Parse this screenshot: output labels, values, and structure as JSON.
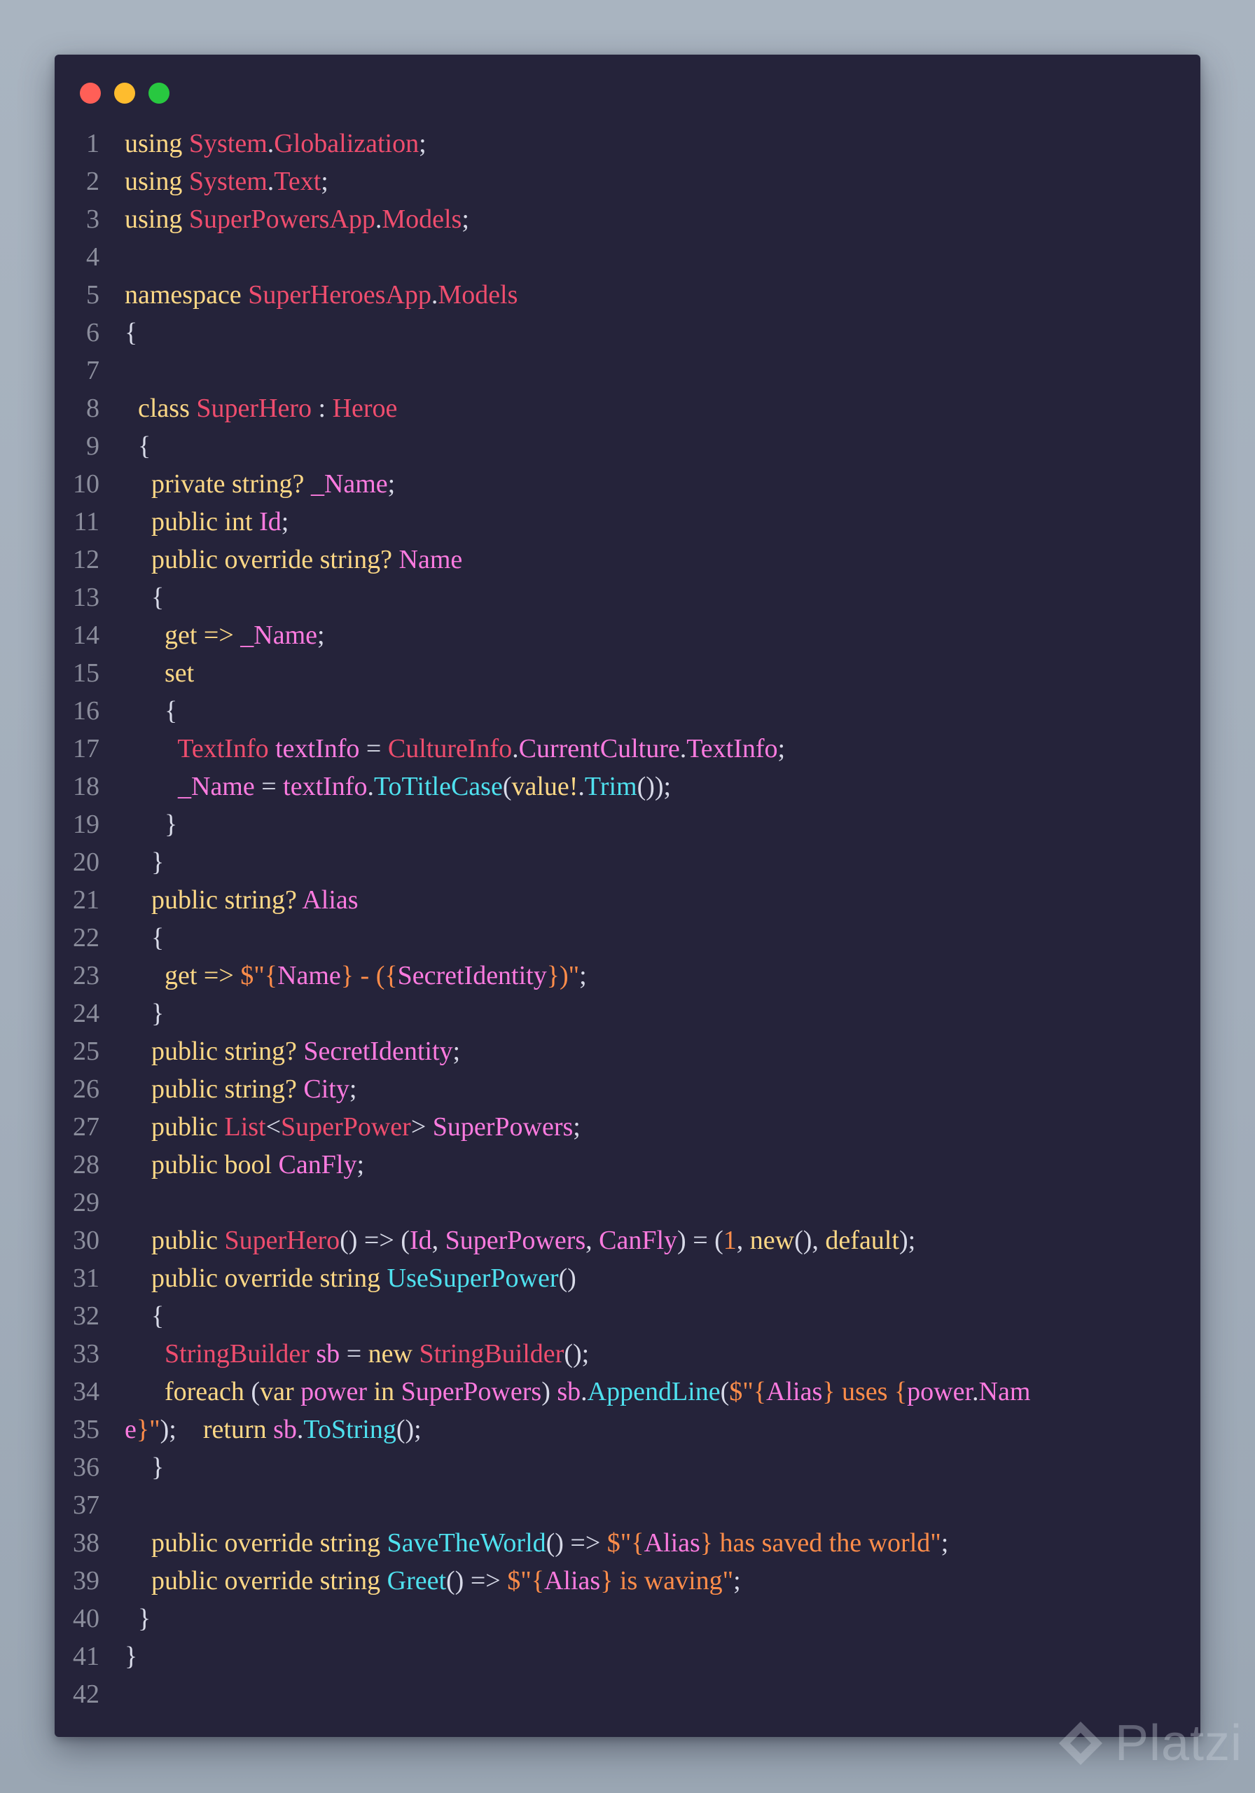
{
  "window": {
    "buttons": [
      {
        "name": "close",
        "color": "#ff5f57"
      },
      {
        "name": "minimize",
        "color": "#febc2e"
      },
      {
        "name": "maximize",
        "color": "#28c840"
      }
    ]
  },
  "watermark": {
    "text": "Platzi",
    "icon": "platzi-logo-icon"
  },
  "colors": {
    "background": "#a6b1bd",
    "editor": "#25233a",
    "keyword": "#fdd886",
    "type": "#ef4d6e",
    "identifier": "#fd7be0",
    "function": "#4fe1ef",
    "string": "#ff8d4a",
    "punctuation": "#d8dae8",
    "line_number": "#8b8d9c"
  },
  "code": {
    "lines": [
      {
        "n": "1",
        "tokens": [
          [
            "kw",
            "using "
          ],
          [
            "ty",
            "System"
          ],
          [
            "pu",
            "."
          ],
          [
            "ty",
            "Globalization"
          ],
          [
            "pu",
            ";"
          ]
        ]
      },
      {
        "n": "2",
        "tokens": [
          [
            "kw",
            "using "
          ],
          [
            "ty",
            "System"
          ],
          [
            "pu",
            "."
          ],
          [
            "ty",
            "Text"
          ],
          [
            "pu",
            ";"
          ]
        ]
      },
      {
        "n": "3",
        "tokens": [
          [
            "kw",
            "using "
          ],
          [
            "ty",
            "SuperPowersApp"
          ],
          [
            "pu",
            "."
          ],
          [
            "ty",
            "Models"
          ],
          [
            "pu",
            ";"
          ]
        ]
      },
      {
        "n": "4",
        "tokens": []
      },
      {
        "n": "5",
        "tokens": [
          [
            "kw",
            "namespace "
          ],
          [
            "ty",
            "SuperHeroesApp"
          ],
          [
            "pu",
            "."
          ],
          [
            "ty",
            "Models"
          ]
        ]
      },
      {
        "n": "6",
        "tokens": [
          [
            "pu",
            "{"
          ]
        ]
      },
      {
        "n": "7",
        "tokens": []
      },
      {
        "n": "8",
        "tokens": [
          [
            "pu",
            "  "
          ],
          [
            "kw",
            "class "
          ],
          [
            "ty",
            "SuperHero"
          ],
          [
            "pu",
            " : "
          ],
          [
            "ty",
            "Heroe"
          ]
        ]
      },
      {
        "n": "9",
        "tokens": [
          [
            "pu",
            "  {"
          ]
        ]
      },
      {
        "n": "10",
        "tokens": [
          [
            "pu",
            "    "
          ],
          [
            "kw",
            "private string? "
          ],
          [
            "id",
            "_Name"
          ],
          [
            "pu",
            ";"
          ]
        ]
      },
      {
        "n": "11",
        "tokens": [
          [
            "pu",
            "    "
          ],
          [
            "kw",
            "public int "
          ],
          [
            "id",
            "Id"
          ],
          [
            "pu",
            ";"
          ]
        ]
      },
      {
        "n": "12",
        "tokens": [
          [
            "pu",
            "    "
          ],
          [
            "kw",
            "public override string? "
          ],
          [
            "id",
            "Name"
          ]
        ]
      },
      {
        "n": "13",
        "tokens": [
          [
            "pu",
            "    {"
          ]
        ]
      },
      {
        "n": "14",
        "tokens": [
          [
            "pu",
            "      "
          ],
          [
            "kw",
            "get => "
          ],
          [
            "id",
            "_Name"
          ],
          [
            "pu",
            ";"
          ]
        ]
      },
      {
        "n": "15",
        "tokens": [
          [
            "pu",
            "      "
          ],
          [
            "kw",
            "set"
          ]
        ]
      },
      {
        "n": "16",
        "tokens": [
          [
            "pu",
            "      {"
          ]
        ]
      },
      {
        "n": "17",
        "tokens": [
          [
            "pu",
            "        "
          ],
          [
            "ty",
            "TextInfo "
          ],
          [
            "id",
            "textInfo"
          ],
          [
            "pu",
            " = "
          ],
          [
            "ty",
            "CultureInfo"
          ],
          [
            "pu",
            "."
          ],
          [
            "id",
            "CurrentCulture"
          ],
          [
            "pu",
            "."
          ],
          [
            "id",
            "TextInfo"
          ],
          [
            "pu",
            ";"
          ]
        ]
      },
      {
        "n": "18",
        "tokens": [
          [
            "pu",
            "        "
          ],
          [
            "id",
            "_Name"
          ],
          [
            "pu",
            " = "
          ],
          [
            "id",
            "textInfo"
          ],
          [
            "pu",
            "."
          ],
          [
            "fn",
            "ToTitleCase"
          ],
          [
            "pu",
            "("
          ],
          [
            "kw",
            "value!"
          ],
          [
            "pu",
            "."
          ],
          [
            "fn",
            "Trim"
          ],
          [
            "pu",
            "());"
          ]
        ]
      },
      {
        "n": "19",
        "tokens": [
          [
            "pu",
            "      }"
          ]
        ]
      },
      {
        "n": "20",
        "tokens": [
          [
            "pu",
            "    }"
          ]
        ]
      },
      {
        "n": "21",
        "tokens": [
          [
            "pu",
            "    "
          ],
          [
            "kw",
            "public string? "
          ],
          [
            "id",
            "Alias"
          ]
        ]
      },
      {
        "n": "22",
        "tokens": [
          [
            "pu",
            "    {"
          ]
        ]
      },
      {
        "n": "23",
        "tokens": [
          [
            "pu",
            "      "
          ],
          [
            "kw",
            "get => "
          ],
          [
            "str",
            "$\"{"
          ],
          [
            "id",
            "Name"
          ],
          [
            "str",
            "} - ({"
          ],
          [
            "id",
            "SecretIdentity"
          ],
          [
            "str",
            "})\""
          ],
          [
            "pu",
            ";"
          ]
        ]
      },
      {
        "n": "24",
        "tokens": [
          [
            "pu",
            "    }"
          ]
        ]
      },
      {
        "n": "25",
        "tokens": [
          [
            "pu",
            "    "
          ],
          [
            "kw",
            "public string? "
          ],
          [
            "id",
            "SecretIdentity"
          ],
          [
            "pu",
            ";"
          ]
        ]
      },
      {
        "n": "26",
        "tokens": [
          [
            "pu",
            "    "
          ],
          [
            "kw",
            "public string? "
          ],
          [
            "id",
            "City"
          ],
          [
            "pu",
            ";"
          ]
        ]
      },
      {
        "n": "27",
        "tokens": [
          [
            "pu",
            "    "
          ],
          [
            "kw",
            "public "
          ],
          [
            "ty",
            "List"
          ],
          [
            "pu",
            "<"
          ],
          [
            "ty",
            "SuperPower"
          ],
          [
            "pu",
            "> "
          ],
          [
            "id",
            "SuperPowers"
          ],
          [
            "pu",
            ";"
          ]
        ]
      },
      {
        "n": "28",
        "tokens": [
          [
            "pu",
            "    "
          ],
          [
            "kw",
            "public bool "
          ],
          [
            "id",
            "CanFly"
          ],
          [
            "pu",
            ";"
          ]
        ]
      },
      {
        "n": "29",
        "tokens": []
      },
      {
        "n": "30",
        "tokens": [
          [
            "pu",
            "    "
          ],
          [
            "kw",
            "public "
          ],
          [
            "ty",
            "SuperHero"
          ],
          [
            "pu",
            "() => ("
          ],
          [
            "id",
            "Id"
          ],
          [
            "pu",
            ", "
          ],
          [
            "id",
            "SuperPowers"
          ],
          [
            "pu",
            ", "
          ],
          [
            "id",
            "CanFly"
          ],
          [
            "pu",
            ") = ("
          ],
          [
            "num",
            "1"
          ],
          [
            "pu",
            ", "
          ],
          [
            "kw",
            "new"
          ],
          [
            "pu",
            "(), "
          ],
          [
            "kw",
            "default"
          ],
          [
            "pu",
            ");"
          ]
        ]
      },
      {
        "n": "31",
        "tokens": [
          [
            "pu",
            "    "
          ],
          [
            "kw",
            "public override string "
          ],
          [
            "fn",
            "UseSuperPower"
          ],
          [
            "pu",
            "()"
          ]
        ]
      },
      {
        "n": "32",
        "tokens": [
          [
            "pu",
            "    {"
          ]
        ]
      },
      {
        "n": "33",
        "tokens": [
          [
            "pu",
            "      "
          ],
          [
            "ty",
            "StringBuilder "
          ],
          [
            "id",
            "sb"
          ],
          [
            "pu",
            " = "
          ],
          [
            "kw",
            "new "
          ],
          [
            "ty",
            "StringBuilder"
          ],
          [
            "pu",
            "();"
          ]
        ]
      },
      {
        "n": "34",
        "tokens": [
          [
            "pu",
            "      "
          ],
          [
            "kw",
            "foreach "
          ],
          [
            "pu",
            "("
          ],
          [
            "kw",
            "var "
          ],
          [
            "id",
            "power"
          ],
          [
            "kw",
            " in "
          ],
          [
            "id",
            "SuperPowers"
          ],
          [
            "pu",
            ") "
          ],
          [
            "id",
            "sb"
          ],
          [
            "pu",
            "."
          ],
          [
            "fn",
            "AppendLine"
          ],
          [
            "pu",
            "("
          ],
          [
            "str",
            "$\"{"
          ],
          [
            "id",
            "Alias"
          ],
          [
            "str",
            "} uses {"
          ],
          [
            "id",
            "power"
          ],
          [
            "pu",
            "."
          ],
          [
            "id",
            "Nam"
          ]
        ]
      },
      {
        "n": "35",
        "tokens": [
          [
            "id",
            "e"
          ],
          [
            "str",
            "}\""
          ],
          [
            "pu",
            ");    "
          ],
          [
            "kw",
            "return "
          ],
          [
            "id",
            "sb"
          ],
          [
            "pu",
            "."
          ],
          [
            "fn",
            "ToString"
          ],
          [
            "pu",
            "();"
          ]
        ]
      },
      {
        "n": "36",
        "tokens": [
          [
            "pu",
            "    }"
          ]
        ]
      },
      {
        "n": "37",
        "tokens": []
      },
      {
        "n": "38",
        "tokens": [
          [
            "pu",
            "    "
          ],
          [
            "kw",
            "public override string "
          ],
          [
            "fn",
            "SaveTheWorld"
          ],
          [
            "pu",
            "() => "
          ],
          [
            "str",
            "$\"{"
          ],
          [
            "id",
            "Alias"
          ],
          [
            "str",
            "} has saved the world\""
          ],
          [
            "pu",
            ";"
          ]
        ]
      },
      {
        "n": "39",
        "tokens": [
          [
            "pu",
            "    "
          ],
          [
            "kw",
            "public override string "
          ],
          [
            "fn",
            "Greet"
          ],
          [
            "pu",
            "() => "
          ],
          [
            "str",
            "$\"{"
          ],
          [
            "id",
            "Alias"
          ],
          [
            "str",
            "} is waving\""
          ],
          [
            "pu",
            ";"
          ]
        ]
      },
      {
        "n": "40",
        "tokens": [
          [
            "pu",
            "  }"
          ]
        ]
      },
      {
        "n": "41",
        "tokens": [
          [
            "pu",
            "}"
          ]
        ]
      },
      {
        "n": "42",
        "tokens": []
      }
    ]
  }
}
